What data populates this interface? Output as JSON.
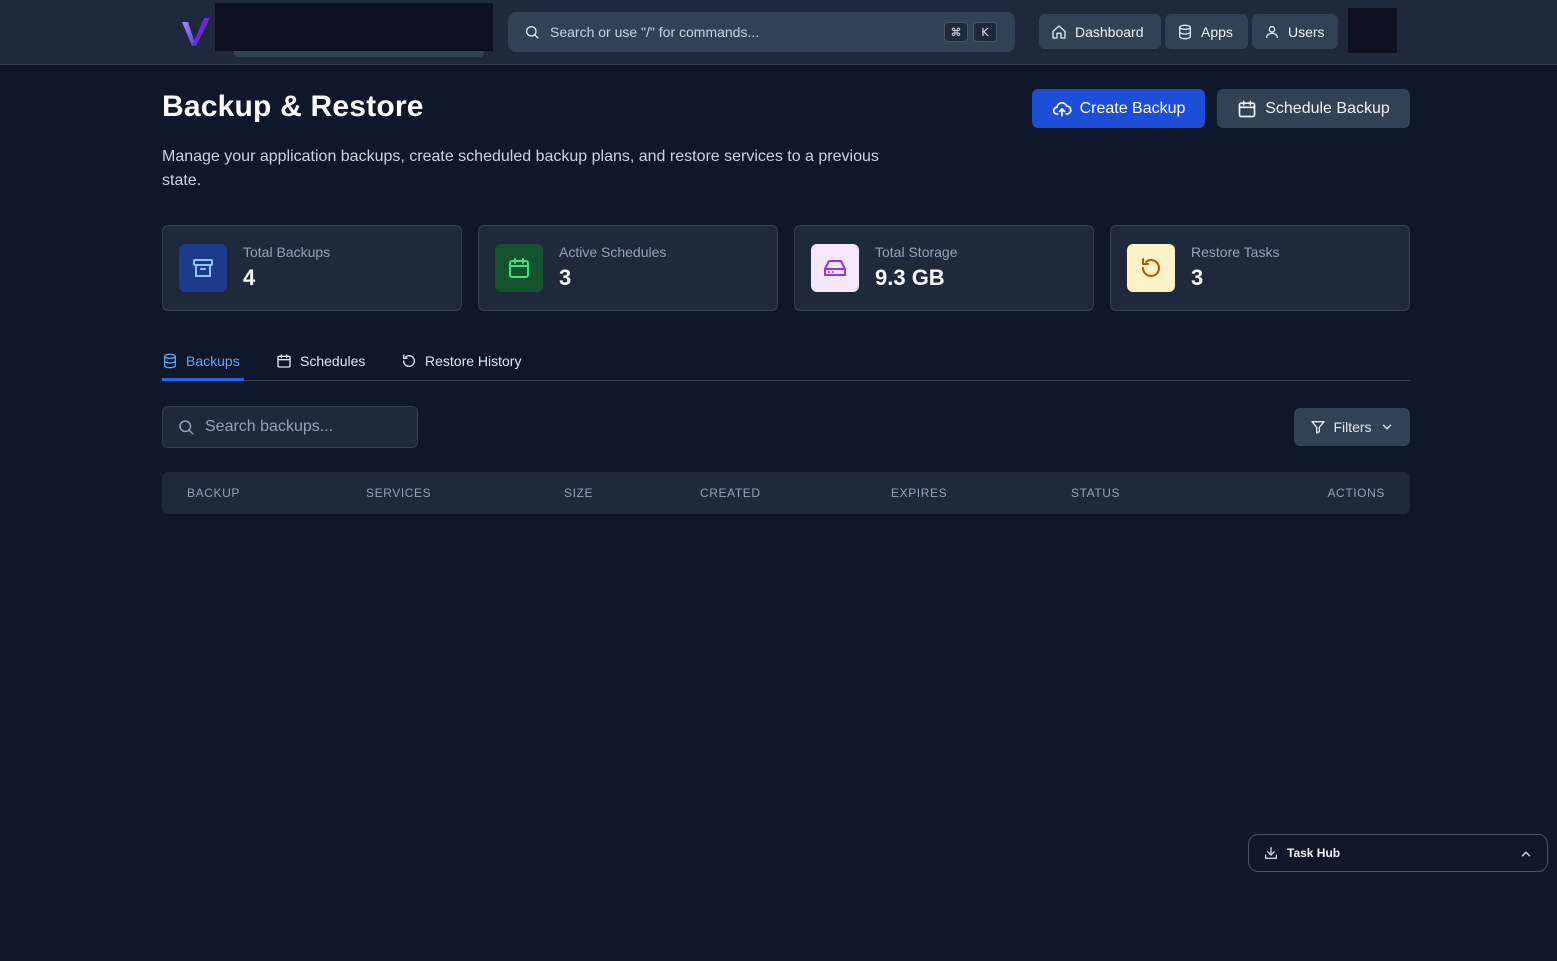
{
  "topbar": {
    "search_placeholder": "Search or use \"/\" for commands...",
    "shortcut_keys": [
      "⌘",
      "K"
    ],
    "nav": [
      {
        "label": "Dashboard",
        "icon": "home-icon"
      },
      {
        "label": "Apps",
        "icon": "database-icon"
      },
      {
        "label": "Users",
        "icon": "user-icon"
      }
    ]
  },
  "header": {
    "title": "Backup & Restore",
    "description": "Manage your application backups, create scheduled backup plans, and restore services to a previous state.",
    "create_label": "Create Backup",
    "schedule_label": "Schedule Backup"
  },
  "stats": [
    {
      "label": "Total Backups",
      "value": "4",
      "icon": "archive-icon",
      "icon_bg": "#1e3a8a",
      "icon_color": "#93c5fd"
    },
    {
      "label": "Active Schedules",
      "value": "3",
      "icon": "calendar-icon",
      "icon_bg": "#14532d",
      "icon_color": "#4ade80"
    },
    {
      "label": "Total Storage",
      "value": "9.3 GB",
      "icon": "hard-drive-icon",
      "icon_bg": "#f3e8ff",
      "icon_color": "#9333ea"
    },
    {
      "label": "Restore Tasks",
      "value": "3",
      "icon": "restore-icon",
      "icon_bg": "#fef3c7",
      "icon_color": "#b45309"
    }
  ],
  "tabs": [
    {
      "label": "Backups",
      "icon": "database-icon",
      "active": true
    },
    {
      "label": "Schedules",
      "icon": "calendar-icon",
      "active": false
    },
    {
      "label": "Restore History",
      "icon": "history-icon",
      "active": false
    }
  ],
  "table": {
    "search_placeholder": "Search backups...",
    "filters_label": "Filters",
    "columns": [
      "BACKUP",
      "SERVICES",
      "SIZE",
      "CREATED",
      "EXPIRES",
      "STATUS",
      "ACTIONS"
    ]
  },
  "taskhub": {
    "label": "Task Hub"
  },
  "colors": {
    "accent": "#1d4ed8",
    "background": "#0f172a",
    "surface": "#1e293b"
  }
}
